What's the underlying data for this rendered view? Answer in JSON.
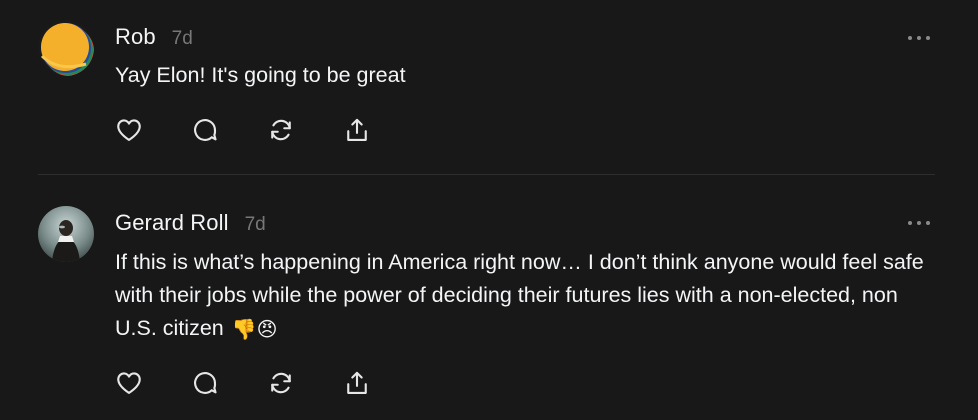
{
  "posts": [
    {
      "author": "Rob",
      "time": "7d",
      "text": "Yay Elon! It's going to be great",
      "avatar_icon": "abstract-orange-circle-avatar",
      "actions": [
        "like-icon",
        "comment-icon",
        "repost-icon",
        "share-icon"
      ]
    },
    {
      "author": "Gerard Roll",
      "time": "7d",
      "text": "If this is what’s happening in America right now… I don’t think anyone would feel safe with their jobs while the power of deciding their futures lies with a non-elected, non U.S. citizen",
      "emoji": "👎😠",
      "avatar_icon": "photo-avatar",
      "actions": [
        "like-icon",
        "comment-icon",
        "repost-icon",
        "share-icon"
      ]
    }
  ],
  "colors": {
    "background": "#181818",
    "text": "#f3f5f7",
    "secondary_text": "#777777",
    "divider": "#2e2e2e",
    "icon": "#e6e6e6"
  }
}
